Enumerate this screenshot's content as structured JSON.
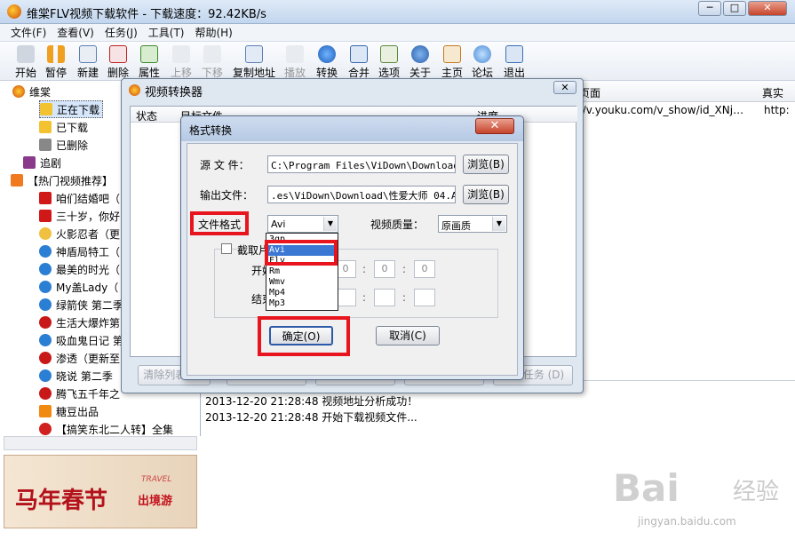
{
  "window": {
    "title": "维棠FLV视频下载软件 - 下载速度：92.42KB/s",
    "controls": [
      "─",
      "□",
      "✕"
    ]
  },
  "menu": [
    "文件(F)",
    "查看(V)",
    "任务(J)",
    "工具(T)",
    "帮助(H)"
  ],
  "toolbar": [
    "开始",
    "暂停",
    "新建",
    "删除",
    "属性",
    "上移",
    "下移",
    "复制地址",
    "播放",
    "转换",
    "合并",
    "选项",
    "关于",
    "主页",
    "论坛",
    "退出"
  ],
  "tree": {
    "root": "维棠",
    "downloading": "正在下载",
    "downloaded": "已下载",
    "deleted": "已删除",
    "chase": "追剧",
    "hot": "【热门视频推荐】",
    "items": [
      "咱们结婚吧（",
      "三十岁，你好",
      "火影忍者（更",
      "神盾局特工（",
      "最美的时光（",
      "My盖Lady（",
      "绿箭侠 第二季",
      "生活大爆炸第",
      "吸血鬼日记 第",
      "渗透（更新至",
      "晓说 第二季",
      "腾飞五千年之",
      "糖豆出品",
      "【搞笑东北二人转】全集"
    ]
  },
  "banner": {
    "text": "马年春节",
    "sub": "出境游",
    "en": "TRAVEL"
  },
  "right_header": {
    "page_col": "页面",
    "real_col": "真实"
  },
  "url_row": {
    "page": "p://v.youku.com/v_show/id_XNj…",
    "real": "http:"
  },
  "log": [
    "2013-12-20 21:28:48 视频地址分析成功！",
    "2013-12-20 21:28:48 开始下载视频文件..."
  ],
  "video_converter": {
    "title": "视频转换器",
    "close": "✕",
    "headers": [
      "状态",
      "目标文件",
      "进度"
    ],
    "buttons": [
      "清除列表 (C)",
      "新建任务 (N)",
      "开始任务 (S)",
      "停止任务 (P)",
      "删除任务 (D)"
    ]
  },
  "format_dialog": {
    "title": "格式转换",
    "close": "✕",
    "source_label": "源 文 件：",
    "source_value": "C:\\Program Files\\ViDown\\Download\\性",
    "browse1": "浏览(B)",
    "output_label": "输出文件：",
    "output_value": ".es\\ViDown\\Download\\性爱大师 04.Avi",
    "browse2": "浏览(B)",
    "format_label": "文件格式",
    "format_value": "Avi",
    "quality_label": "视频质量：",
    "quality_value": "原画质",
    "clip_checkbox": "截取片段",
    "start_label": "开始",
    "end_label": "结束",
    "time_values": [
      "0",
      "0",
      "0"
    ],
    "ok": "确定(O)",
    "cancel": "取消(C)",
    "dropdown_options": [
      "3gp",
      "Avi",
      "Flv",
      "Rm",
      "Wmv",
      "Mp4",
      "Mp3"
    ],
    "dropdown_selected": "Avi"
  },
  "watermark": {
    "brand": "Bai",
    "brand2": "经验",
    "url": "jingyan.baidu.com"
  },
  "colors": {
    "highlight": "#e8141e",
    "selection": "#3a78d4"
  }
}
